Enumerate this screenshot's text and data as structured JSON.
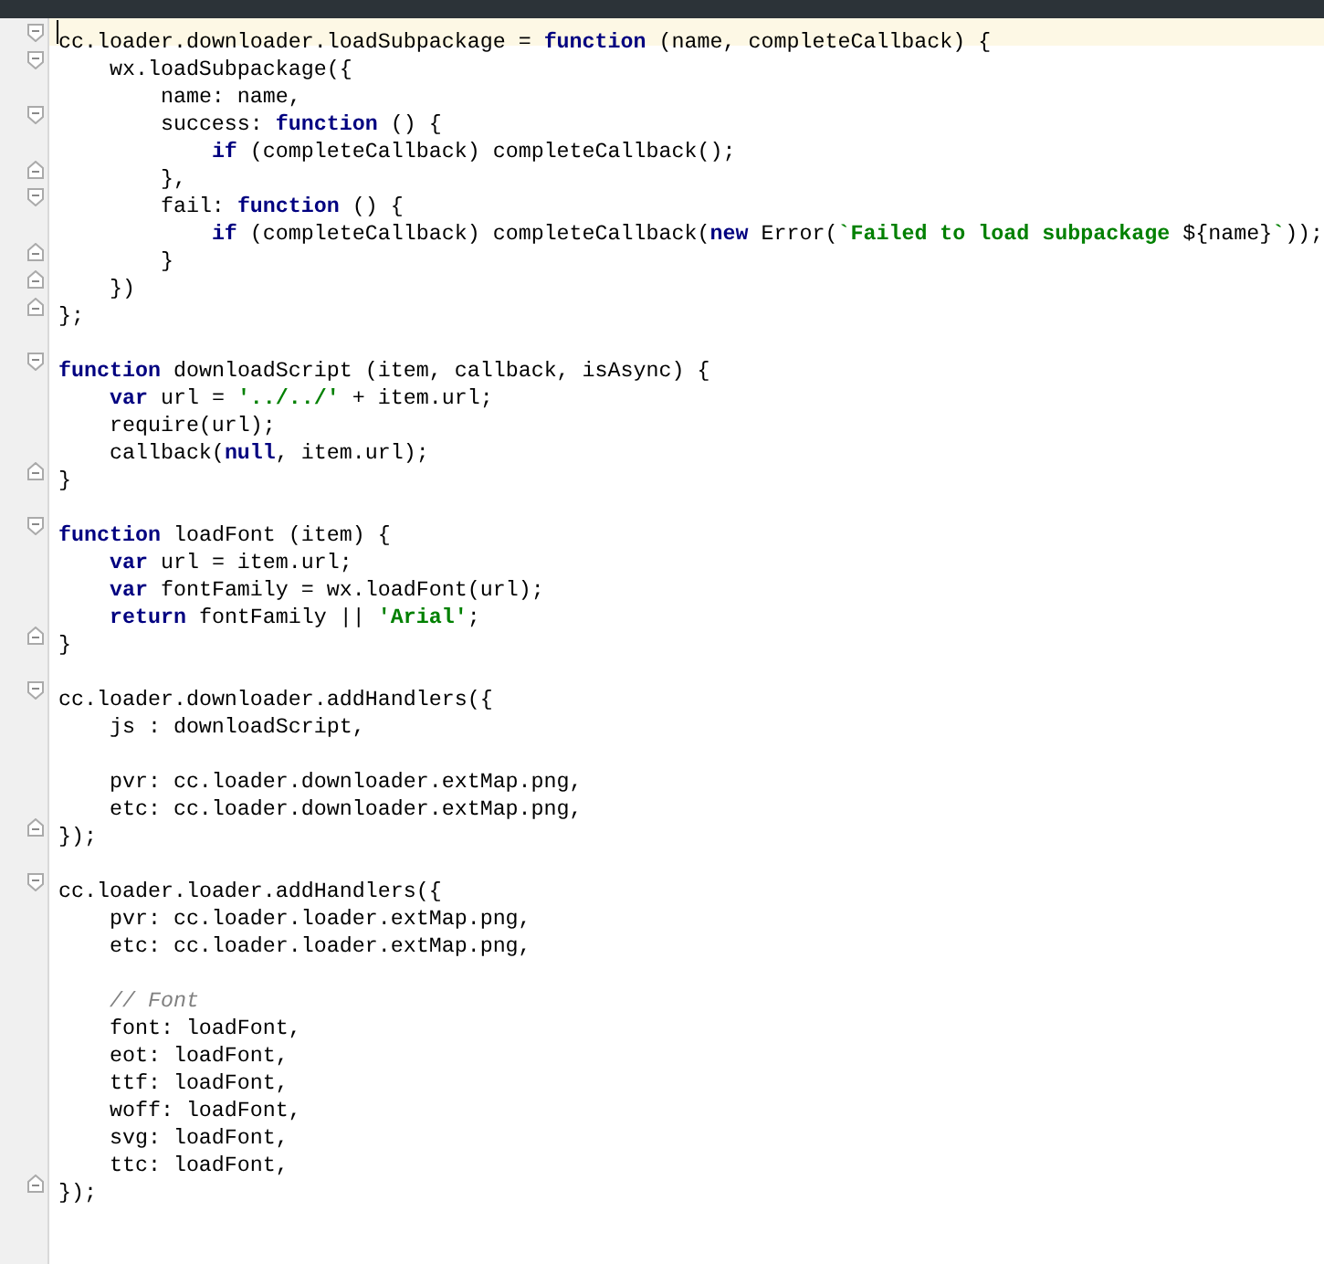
{
  "editor": {
    "lines": [
      {
        "kind": "code",
        "current": true,
        "fold_start": true,
        "fold_end": false,
        "tokens": [
          {
            "kind": "plain",
            "text": "cc.loader.downloader.loadSubpackage = "
          },
          {
            "kind": "keyword",
            "text": "function"
          },
          {
            "kind": "plain",
            "text": " (name, completeCallback) {"
          }
        ]
      },
      {
        "kind": "code",
        "current": false,
        "fold_start": true,
        "fold_end": false,
        "tokens": [
          {
            "kind": "plain",
            "text": "    wx.loadSubpackage({"
          }
        ]
      },
      {
        "kind": "code",
        "current": false,
        "fold_start": false,
        "fold_end": false,
        "tokens": [
          {
            "kind": "plain",
            "text": "        name: name,"
          }
        ]
      },
      {
        "kind": "code",
        "current": false,
        "fold_start": true,
        "fold_end": false,
        "tokens": [
          {
            "kind": "plain",
            "text": "        success: "
          },
          {
            "kind": "keyword",
            "text": "function"
          },
          {
            "kind": "plain",
            "text": " () {"
          }
        ]
      },
      {
        "kind": "code",
        "current": false,
        "fold_start": false,
        "fold_end": false,
        "tokens": [
          {
            "kind": "keyword",
            "text": "            if"
          },
          {
            "kind": "plain",
            "text": " (completeCallback) completeCallback();"
          }
        ]
      },
      {
        "kind": "code",
        "current": false,
        "fold_start": false,
        "fold_end": true,
        "tokens": [
          {
            "kind": "plain",
            "text": "        },"
          }
        ]
      },
      {
        "kind": "code",
        "current": false,
        "fold_start": true,
        "fold_end": false,
        "tokens": [
          {
            "kind": "plain",
            "text": "        fail: "
          },
          {
            "kind": "keyword",
            "text": "function"
          },
          {
            "kind": "plain",
            "text": " () {"
          }
        ]
      },
      {
        "kind": "code",
        "current": false,
        "fold_start": false,
        "fold_end": false,
        "tokens": [
          {
            "kind": "keyword",
            "text": "            if"
          },
          {
            "kind": "plain",
            "text": " (completeCallback) completeCallback("
          },
          {
            "kind": "keyword",
            "text": "new"
          },
          {
            "kind": "plain",
            "text": " Error("
          },
          {
            "kind": "string",
            "text": "`Failed to load subpackage "
          },
          {
            "kind": "plain",
            "text": "${name}"
          },
          {
            "kind": "string",
            "text": "`"
          },
          {
            "kind": "plain",
            "text": "));"
          }
        ]
      },
      {
        "kind": "code",
        "current": false,
        "fold_start": false,
        "fold_end": true,
        "tokens": [
          {
            "kind": "plain",
            "text": "        }"
          }
        ]
      },
      {
        "kind": "code",
        "current": false,
        "fold_start": false,
        "fold_end": true,
        "tokens": [
          {
            "kind": "plain",
            "text": "    })"
          }
        ]
      },
      {
        "kind": "code",
        "current": false,
        "fold_start": false,
        "fold_end": true,
        "tokens": [
          {
            "kind": "plain",
            "text": "};"
          }
        ]
      },
      {
        "kind": "blank"
      },
      {
        "kind": "code",
        "current": false,
        "fold_start": true,
        "fold_end": false,
        "tokens": [
          {
            "kind": "keyword",
            "text": "function"
          },
          {
            "kind": "plain",
            "text": " downloadScript (item, callback, isAsync) {"
          }
        ]
      },
      {
        "kind": "code",
        "current": false,
        "fold_start": false,
        "fold_end": false,
        "tokens": [
          {
            "kind": "keyword",
            "text": "    var"
          },
          {
            "kind": "plain",
            "text": " url = "
          },
          {
            "kind": "string",
            "text": "'../../'"
          },
          {
            "kind": "plain",
            "text": " + item.url;"
          }
        ]
      },
      {
        "kind": "code",
        "current": false,
        "fold_start": false,
        "fold_end": false,
        "tokens": [
          {
            "kind": "plain",
            "text": "    require(url);"
          }
        ]
      },
      {
        "kind": "code",
        "current": false,
        "fold_start": false,
        "fold_end": false,
        "tokens": [
          {
            "kind": "plain",
            "text": "    callback("
          },
          {
            "kind": "keyword",
            "text": "null"
          },
          {
            "kind": "plain",
            "text": ", item.url);"
          }
        ]
      },
      {
        "kind": "code",
        "current": false,
        "fold_start": false,
        "fold_end": true,
        "tokens": [
          {
            "kind": "plain",
            "text": "}"
          }
        ]
      },
      {
        "kind": "blank"
      },
      {
        "kind": "code",
        "current": false,
        "fold_start": true,
        "fold_end": false,
        "tokens": [
          {
            "kind": "keyword",
            "text": "function"
          },
          {
            "kind": "plain",
            "text": " loadFont (item) {"
          }
        ]
      },
      {
        "kind": "code",
        "current": false,
        "fold_start": false,
        "fold_end": false,
        "tokens": [
          {
            "kind": "keyword",
            "text": "    var"
          },
          {
            "kind": "plain",
            "text": " url = item.url;"
          }
        ]
      },
      {
        "kind": "code",
        "current": false,
        "fold_start": false,
        "fold_end": false,
        "tokens": [
          {
            "kind": "keyword",
            "text": "    var"
          },
          {
            "kind": "plain",
            "text": " fontFamily = wx.loadFont(url);"
          }
        ]
      },
      {
        "kind": "code",
        "current": false,
        "fold_start": false,
        "fold_end": false,
        "tokens": [
          {
            "kind": "keyword",
            "text": "    return"
          },
          {
            "kind": "plain",
            "text": " fontFamily || "
          },
          {
            "kind": "string",
            "text": "'Arial'"
          },
          {
            "kind": "plain",
            "text": ";"
          }
        ]
      },
      {
        "kind": "code",
        "current": false,
        "fold_start": false,
        "fold_end": true,
        "tokens": [
          {
            "kind": "plain",
            "text": "}"
          }
        ]
      },
      {
        "kind": "blank"
      },
      {
        "kind": "code",
        "current": false,
        "fold_start": true,
        "fold_end": false,
        "tokens": [
          {
            "kind": "plain",
            "text": "cc.loader.downloader.addHandlers({"
          }
        ]
      },
      {
        "kind": "code",
        "current": false,
        "fold_start": false,
        "fold_end": false,
        "tokens": [
          {
            "kind": "plain",
            "text": "    js : downloadScript,"
          }
        ]
      },
      {
        "kind": "blank"
      },
      {
        "kind": "code",
        "current": false,
        "fold_start": false,
        "fold_end": false,
        "tokens": [
          {
            "kind": "plain",
            "text": "    pvr: cc.loader.downloader.extMap.png,"
          }
        ]
      },
      {
        "kind": "code",
        "current": false,
        "fold_start": false,
        "fold_end": false,
        "tokens": [
          {
            "kind": "plain",
            "text": "    etc: cc.loader.downloader.extMap.png,"
          }
        ]
      },
      {
        "kind": "code",
        "current": false,
        "fold_start": false,
        "fold_end": true,
        "tokens": [
          {
            "kind": "plain",
            "text": "});"
          }
        ]
      },
      {
        "kind": "blank"
      },
      {
        "kind": "code",
        "current": false,
        "fold_start": true,
        "fold_end": false,
        "tokens": [
          {
            "kind": "plain",
            "text": "cc.loader.loader.addHandlers({"
          }
        ]
      },
      {
        "kind": "code",
        "current": false,
        "fold_start": false,
        "fold_end": false,
        "tokens": [
          {
            "kind": "plain",
            "text": "    pvr: cc.loader.loader.extMap.png,"
          }
        ]
      },
      {
        "kind": "code",
        "current": false,
        "fold_start": false,
        "fold_end": false,
        "tokens": [
          {
            "kind": "plain",
            "text": "    etc: cc.loader.loader.extMap.png,"
          }
        ]
      },
      {
        "kind": "blank"
      },
      {
        "kind": "code",
        "current": false,
        "fold_start": false,
        "fold_end": false,
        "tokens": [
          {
            "kind": "comment",
            "text": "    // Font"
          }
        ]
      },
      {
        "kind": "code",
        "current": false,
        "fold_start": false,
        "fold_end": false,
        "tokens": [
          {
            "kind": "plain",
            "text": "    font: loadFont,"
          }
        ]
      },
      {
        "kind": "code",
        "current": false,
        "fold_start": false,
        "fold_end": false,
        "tokens": [
          {
            "kind": "plain",
            "text": "    eot: loadFont,"
          }
        ]
      },
      {
        "kind": "code",
        "current": false,
        "fold_start": false,
        "fold_end": false,
        "tokens": [
          {
            "kind": "plain",
            "text": "    ttf: loadFont,"
          }
        ]
      },
      {
        "kind": "code",
        "current": false,
        "fold_start": false,
        "fold_end": false,
        "tokens": [
          {
            "kind": "plain",
            "text": "    woff: loadFont,"
          }
        ]
      },
      {
        "kind": "code",
        "current": false,
        "fold_start": false,
        "fold_end": false,
        "tokens": [
          {
            "kind": "plain",
            "text": "    svg: loadFont,"
          }
        ]
      },
      {
        "kind": "code",
        "current": false,
        "fold_start": false,
        "fold_end": false,
        "tokens": [
          {
            "kind": "plain",
            "text": "    ttc: loadFont,"
          }
        ]
      },
      {
        "kind": "code",
        "current": false,
        "fold_start": false,
        "fold_end": true,
        "tokens": [
          {
            "kind": "plain",
            "text": "});"
          }
        ]
      }
    ]
  }
}
